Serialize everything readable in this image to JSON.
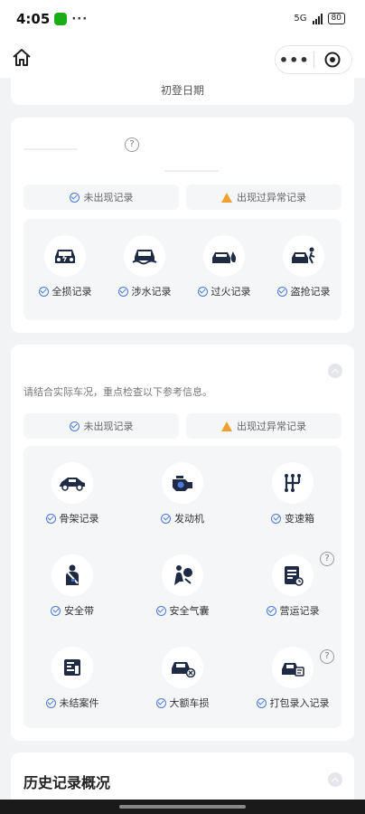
{
  "statusbar": {
    "time": "4:05",
    "dots": "···",
    "network": "5G",
    "battery": "80"
  },
  "navbar": {
    "more": "•••"
  },
  "register_card": {
    "label": "初登日期"
  },
  "section1": {
    "help": "?",
    "legend": {
      "normal": "未出现记录",
      "abnormal": "出现过异常记录"
    },
    "items": [
      {
        "label": "全损记录",
        "icon": "car-front-icon"
      },
      {
        "label": "涉水记录",
        "icon": "car-flood-icon"
      },
      {
        "label": "过火记录",
        "icon": "car-fire-icon"
      },
      {
        "label": "盗抢记录",
        "icon": "car-theft-icon"
      }
    ]
  },
  "section2": {
    "hint": "请结合实际车况，重点检查以下参考信息。",
    "legend": {
      "normal": "未出现记录",
      "abnormal": "出现过异常记录"
    },
    "help": "?",
    "items": [
      {
        "label": "骨架记录",
        "icon": "car-side-icon"
      },
      {
        "label": "发动机",
        "icon": "engine-icon"
      },
      {
        "label": "变速箱",
        "icon": "gearbox-icon"
      },
      {
        "label": "安全带",
        "icon": "seatbelt-icon"
      },
      {
        "label": "安全气囊",
        "icon": "airbag-icon"
      },
      {
        "label": "营运记录",
        "icon": "commercial-doc-icon"
      },
      {
        "label": "未结案件",
        "icon": "open-case-icon"
      },
      {
        "label": "大额车损",
        "icon": "major-damage-icon"
      },
      {
        "label": "打包录入记录",
        "icon": "bundle-record-icon"
      }
    ]
  },
  "section3": {
    "title": "历史记录概况"
  },
  "colors": {
    "navy": "#1f2a44",
    "check": "#4a7bd8",
    "warn": "#f0a030"
  }
}
